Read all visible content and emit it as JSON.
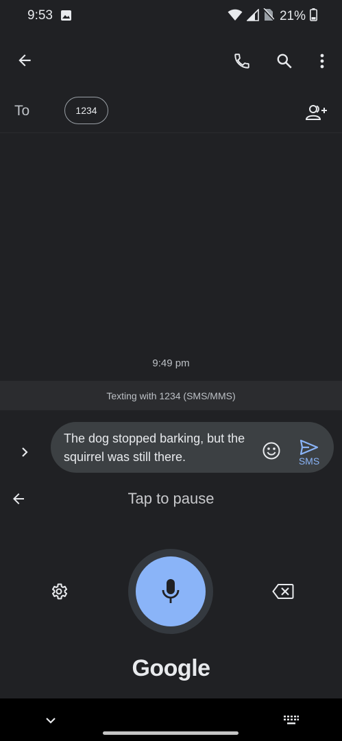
{
  "status_bar": {
    "time": "9:53",
    "battery": "21%",
    "icons": [
      "gallery-icon",
      "wifi-icon",
      "signal-icon",
      "no-sim-icon",
      "battery-icon"
    ]
  },
  "app_bar": {
    "icons": [
      "back-arrow-icon",
      "phone-icon",
      "search-icon",
      "more-vert-icon"
    ]
  },
  "recipient": {
    "label": "To",
    "chip": "1234"
  },
  "conversation": {
    "timestamp": "9:49 pm",
    "banner": "Texting with 1234 (SMS/MMS)"
  },
  "compose": {
    "text": "The dog stopped barking, but the squirrel was still there.",
    "send_label": "SMS"
  },
  "voice_keyboard": {
    "status": "Tap to pause",
    "brand": "Google"
  },
  "colors": {
    "background": "#202124",
    "accent": "#8ab4f8",
    "compose_bg": "#3c4043",
    "banner_bg": "#2b2c2f"
  }
}
